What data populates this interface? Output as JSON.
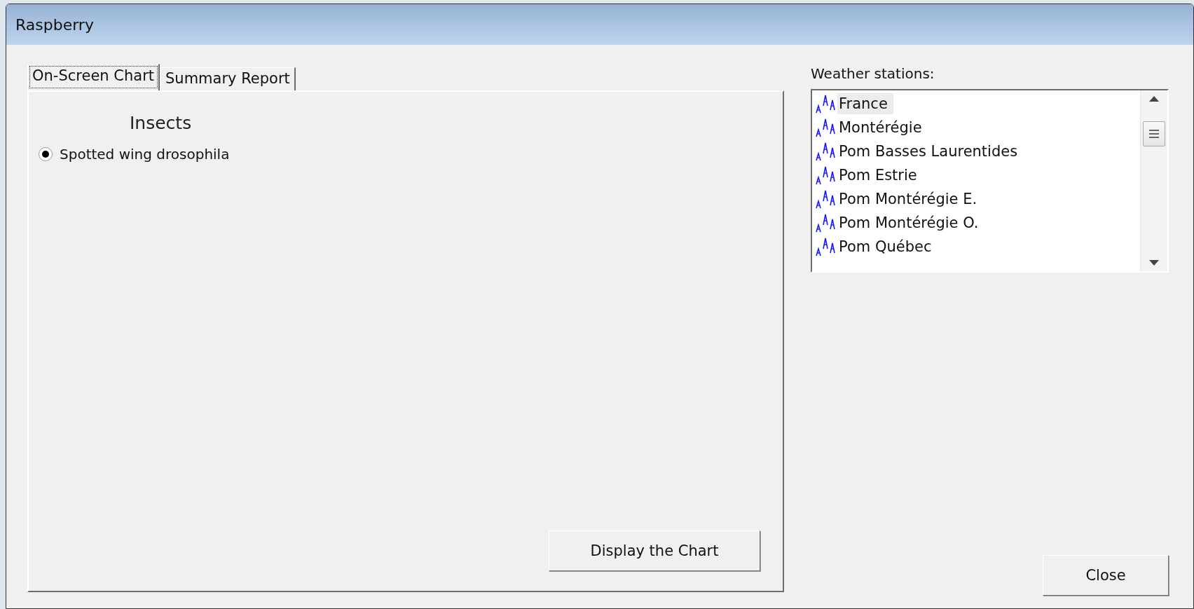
{
  "window": {
    "title": "Raspberry"
  },
  "tabs": [
    {
      "label": "On-Screen Chart",
      "selected": true
    },
    {
      "label": "Summary Report",
      "selected": false
    }
  ],
  "chart_tab": {
    "group_title": "Insects",
    "options": [
      {
        "label": "Spotted wing drosophila",
        "selected": true
      }
    ],
    "button": "Display the Chart"
  },
  "stations": {
    "label": "Weather stations:",
    "items": [
      {
        "name": "France",
        "selected": true
      },
      {
        "name": "Montérégie",
        "selected": false
      },
      {
        "name": "Pom Basses Laurentides",
        "selected": false
      },
      {
        "name": "Pom Estrie",
        "selected": false
      },
      {
        "name": "Pom Montérégie E.",
        "selected": false
      },
      {
        "name": "Pom Montérégie O.",
        "selected": false
      },
      {
        "name": "Pom Québec",
        "selected": false
      }
    ]
  },
  "buttons": [
    {
      "label": "Close"
    }
  ]
}
